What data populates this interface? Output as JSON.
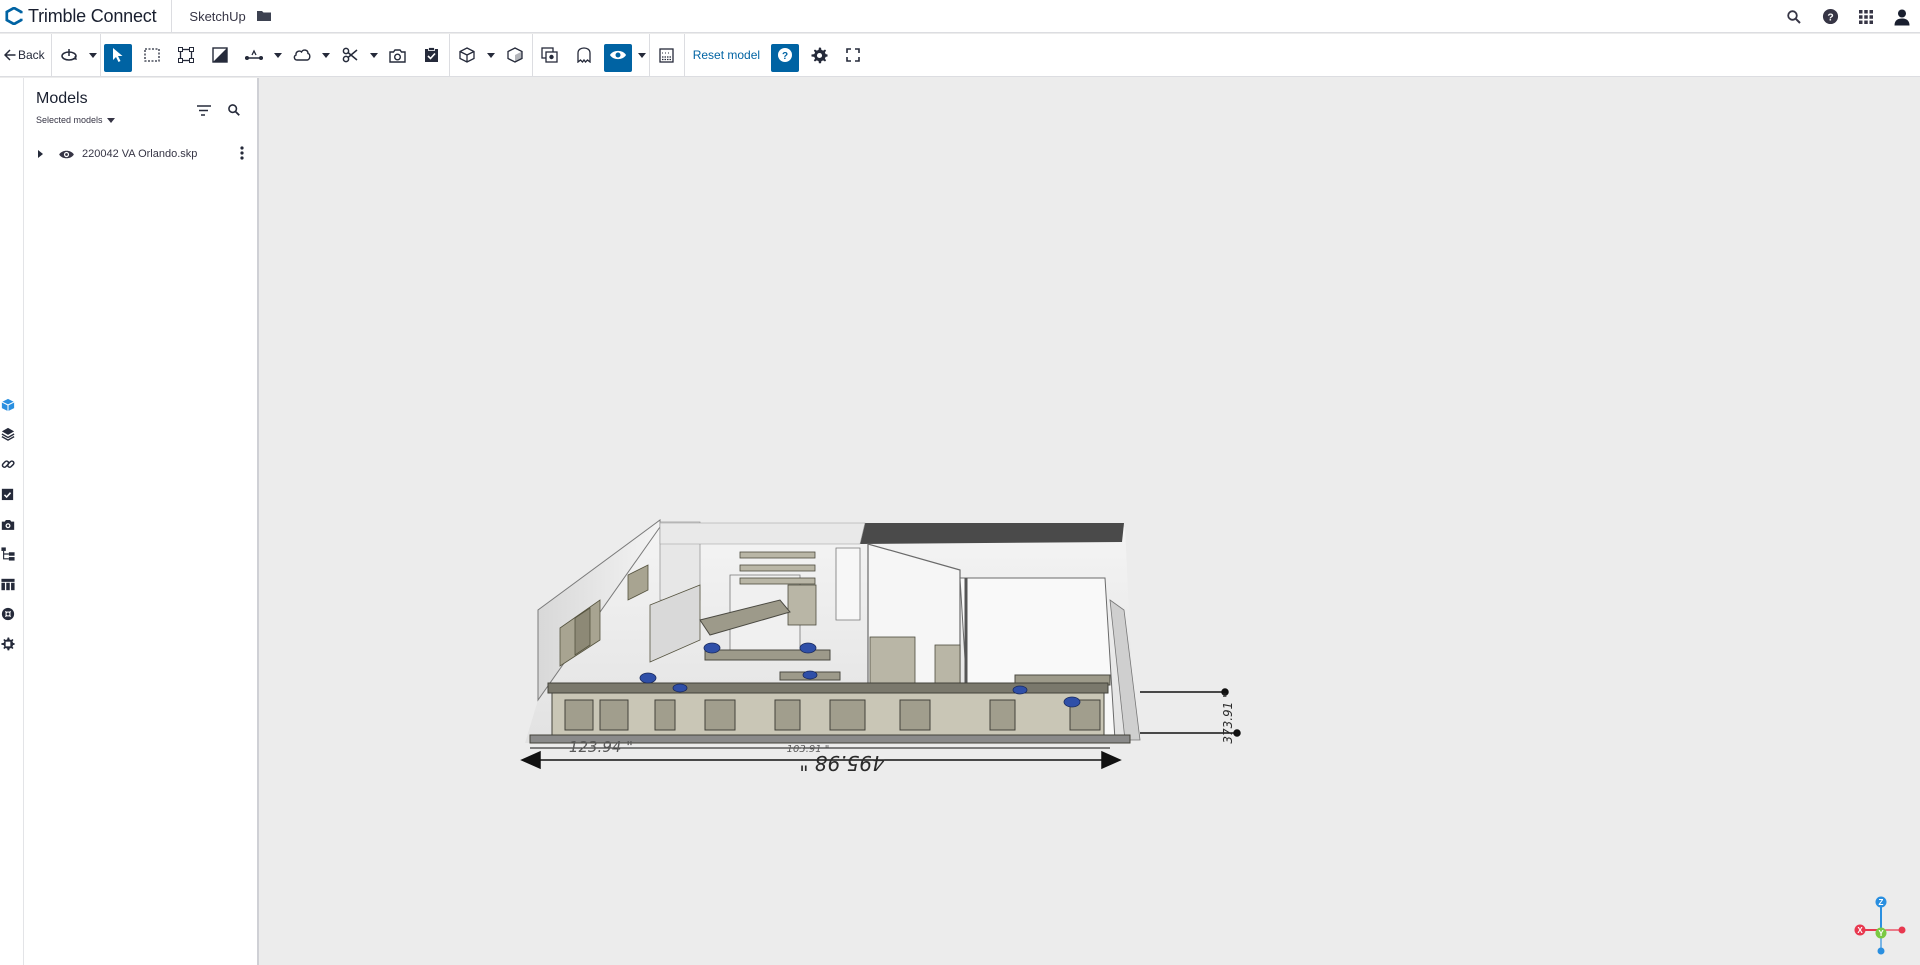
{
  "app": {
    "brand_bold": "Trimble",
    "brand_light": "Connect",
    "project": "SketchUp"
  },
  "appbar_icons": [
    "search-icon",
    "help-icon",
    "apps-grid-icon",
    "user-avatar-icon"
  ],
  "toolbar": {
    "back_label": "Back",
    "reset_label": "Reset model",
    "tools": [
      "orbit",
      "select",
      "area-select",
      "fit-to-selection",
      "section-box",
      "measure",
      "markup",
      "clip",
      "snapshot",
      "todo",
      "view-cube",
      "model-view",
      "render-mode",
      "ghost",
      "visibility",
      "background",
      "help",
      "settings",
      "fullscreen"
    ],
    "active_tools": [
      "select",
      "visibility",
      "help"
    ]
  },
  "rail": {
    "items": [
      "models-icon",
      "layers-icon",
      "link-icon",
      "todo-icon",
      "camera-icon",
      "hierarchy-icon",
      "table-icon",
      "clash-icon",
      "extensions-icon"
    ],
    "active": "models-icon"
  },
  "models_panel": {
    "title": "Models",
    "filter_label": "Selected models",
    "items": [
      {
        "name": "220042 VA Orlando.skp",
        "visible": true
      }
    ]
  },
  "viewport": {
    "dimensions": {
      "overall": "495.98 \"",
      "left_segment": "123.94 \"",
      "middle_segment": "103.91 \"",
      "side": "373.91 \""
    },
    "axis_labels": {
      "x": "X",
      "y": "Y",
      "z": "Z"
    },
    "colors": {
      "x": "#e8384f",
      "y": "#7ac943",
      "z": "#2a8fe0"
    }
  },
  "colors": {
    "accent": "#0063a3",
    "brand": "#191f2f",
    "panel_bg": "#ffffff",
    "viewport_bg": "#ececec"
  }
}
